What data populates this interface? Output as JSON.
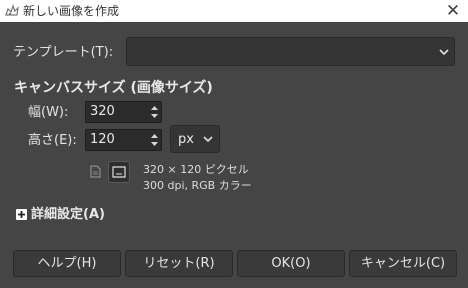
{
  "window": {
    "title": "新しい画像を作成",
    "app_icon": "gimp-wilber-icon",
    "close_icon": "close-icon"
  },
  "template": {
    "label": "テンプレート(T):",
    "value": ""
  },
  "image_size": {
    "section_title": "キャンバスサイズ (画像サイズ)",
    "width_label": "幅(W):",
    "width_value": "320",
    "height_label": "高さ(E):",
    "height_value": "120",
    "unit": "px",
    "info_line1": "320 × 120 ピクセル",
    "info_line2": "300 dpi, RGB カラー"
  },
  "advanced": {
    "label": "詳細設定(A)",
    "icon": "plus-expand-icon"
  },
  "buttons": {
    "help": "ヘルプ(H)",
    "reset": "リセット(R)",
    "ok": "OK(O)",
    "cancel": "キャンセル(C)"
  },
  "colors": {
    "background": "#454545",
    "titlebar": "#ffffff",
    "field": "#2b2b2b",
    "button": "#3a3a3a"
  }
}
